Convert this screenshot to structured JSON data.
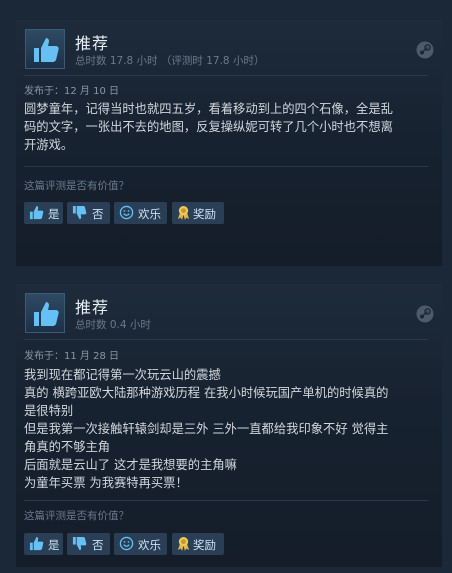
{
  "reviews": [
    {
      "recommendation": "推荐",
      "hours": "总时数 17.8 小时 （评测时 17.8 小时）",
      "posted": "发布于：12 月 10 日",
      "lines": [
        "圆梦童年，记得当时也就四五岁，看着移动到上的四个石像，全是乱",
        "码的文字，一张出不去的地图，反复操纵妮可转了几个小时也不想离",
        "开游戏。"
      ],
      "helpful_question": "这篇评测是否有价值？",
      "buttons": {
        "yes": "是",
        "no": "否",
        "funny": "欢乐",
        "award": "奖励"
      }
    },
    {
      "recommendation": "推荐",
      "hours": "总时数 0.4 小时",
      "posted": "发布于：11 月 28 日",
      "lines": [
        "我到现在都记得第一次玩云山的震撼",
        "真的 横跨亚欧大陆那种游戏历程 在我小时候玩国产单机的时候真的",
        "是很特别",
        "但是我第一次接触轩辕剑却是三外 三外一直都给我印象不好 觉得主",
        "角真的不够主角",
        "后面就是云山了 这才是我想要的主角嘛",
        "为童年买票 为我赛特再买票！"
      ],
      "helpful_question": "这篇评测是否有价值？",
      "buttons": {
        "yes": "是",
        "no": "否",
        "funny": "欢乐",
        "award": "奖励"
      }
    }
  ],
  "icons": {
    "recommend": "thumbs-up-icon",
    "platform": "steam-icon",
    "yes": "thumbs-up-icon",
    "no": "thumbs-down-icon",
    "funny": "smiley-icon",
    "award": "award-icon"
  },
  "colors": {
    "background": "#1b2838",
    "card": "#16202d",
    "button": "#2a3f55",
    "accent": "#66c0f4"
  }
}
